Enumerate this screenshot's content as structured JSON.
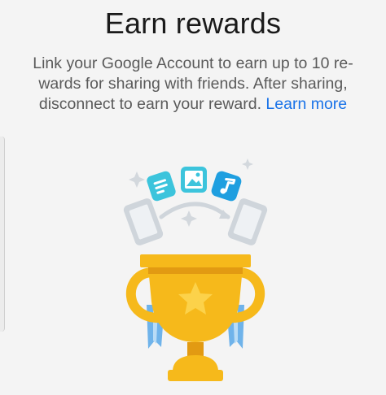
{
  "dialog": {
    "title": "Earn rewards",
    "body_line1": "Link your Google Account to earn up to 10 re-",
    "body_line2": "wards for sharing with friends. After sharing,",
    "body_line3_prefix": "disconnect to earn your reward. ",
    "learn_more_link": "Learn more"
  },
  "colors": {
    "background": "#f4f4f4",
    "title": "#1a1a1a",
    "body_text": "#5a5a5a",
    "link": "#1a73e8",
    "trophy_gold": "#f6b91b",
    "trophy_dark": "#e29a12",
    "star": "#fcd24a",
    "ribbon": "#6fb3ea",
    "accent_cyan": "#3cc4dc",
    "phone_gray": "#cfd5db"
  },
  "illustration": {
    "icons": [
      "document-icon",
      "image-icon",
      "music-note-icon",
      "phone-icon",
      "trophy-icon",
      "star-icon",
      "sparkle-icon",
      "share-arrow-icon"
    ]
  }
}
